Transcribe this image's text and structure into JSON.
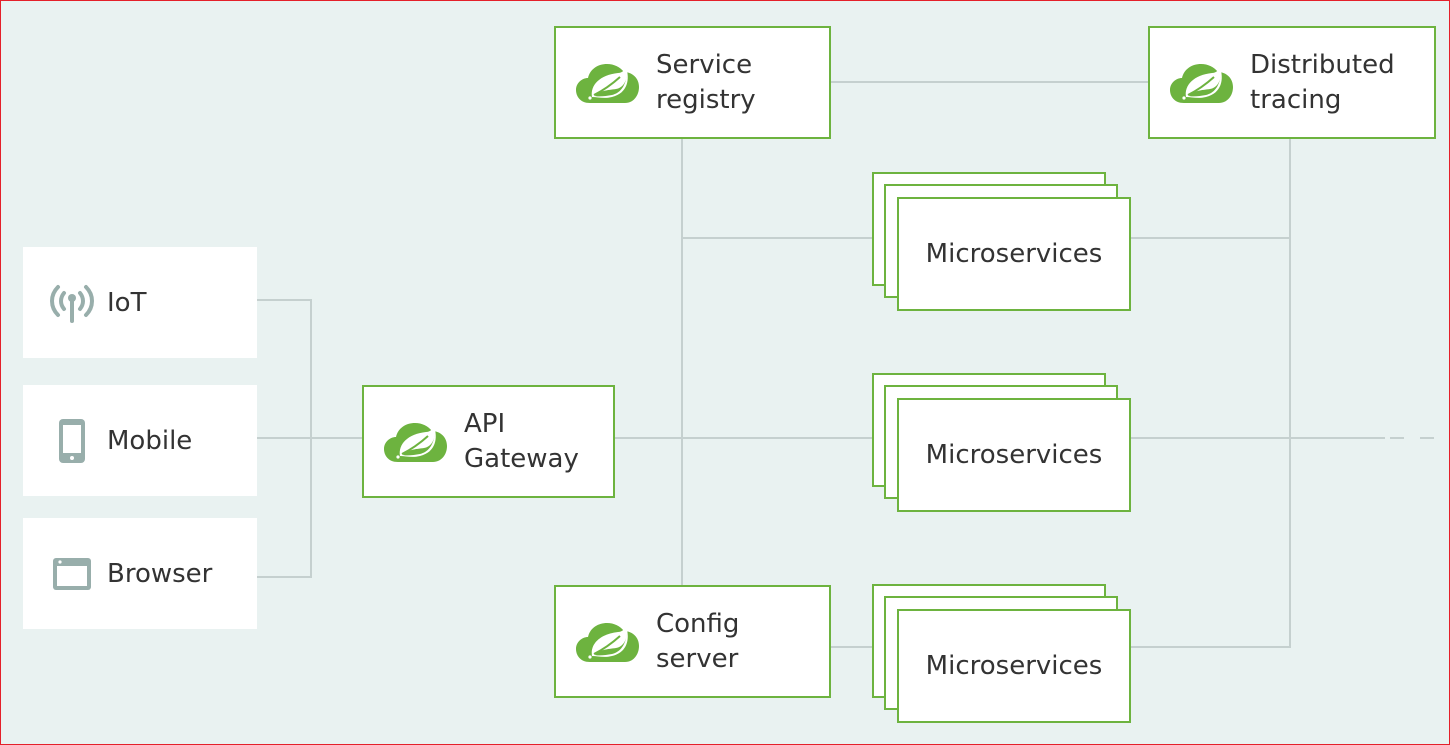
{
  "colors": {
    "accent": "#6db33f",
    "line": "#c5d0cf",
    "background": "#e9f2f1",
    "icon": "#98aeab"
  },
  "clients": [
    {
      "label": "IoT",
      "icon": "antenna-icon"
    },
    {
      "label": "Mobile",
      "icon": "mobile-phone-icon"
    },
    {
      "label": "Browser",
      "icon": "browser-window-icon"
    }
  ],
  "nodes": {
    "gateway": {
      "line1": "API",
      "line2": "Gateway",
      "icon": "spring-logo-icon"
    },
    "registry": {
      "line1": "Service",
      "line2": "registry",
      "icon": "spring-logo-icon"
    },
    "config": {
      "line1": "Config",
      "line2": "server",
      "icon": "spring-logo-icon"
    },
    "tracing": {
      "line1": "Distributed",
      "line2": "tracing",
      "icon": "spring-logo-icon"
    }
  },
  "microservices": [
    {
      "label": "Microservices"
    },
    {
      "label": "Microservices"
    },
    {
      "label": "Microservices"
    }
  ]
}
